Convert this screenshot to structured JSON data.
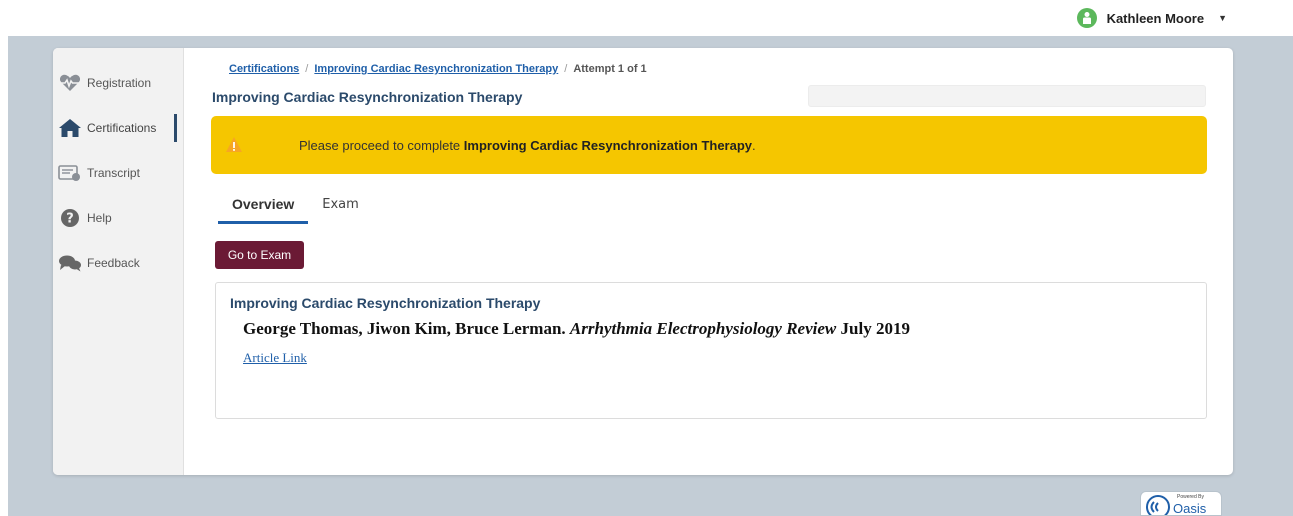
{
  "header": {
    "user_name": "Kathleen Moore"
  },
  "sidebar": {
    "items": [
      {
        "label": "Registration",
        "icon": "heartbeat-icon"
      },
      {
        "label": "Certifications",
        "icon": "home-icon",
        "active": true
      },
      {
        "label": "Transcript",
        "icon": "transcript-icon"
      },
      {
        "label": "Help",
        "icon": "help-icon"
      },
      {
        "label": "Feedback",
        "icon": "feedback-icon"
      }
    ]
  },
  "breadcrumb": {
    "items": [
      "Certifications",
      "Improving Cardiac Resynchronization Therapy"
    ],
    "current": "Attempt 1 of 1"
  },
  "page": {
    "title": "Improving Cardiac Resynchronization Therapy"
  },
  "alert": {
    "prefix": "Please proceed to complete ",
    "bold": "Improving Cardiac Resynchronization Therapy",
    "suffix": "."
  },
  "tabs": [
    {
      "label": "Overview",
      "active": true
    },
    {
      "label": "Exam",
      "active": false
    }
  ],
  "exam_button": {
    "label": "Go to Exam"
  },
  "content": {
    "title": "Improving Cardiac Resynchronization Therapy",
    "authors": "George Thomas, Jiwon Kim, Bruce Lerman. ",
    "journal": "Arrhythmia Electrophysiology Review",
    "date": " July 2019",
    "link_label": "Article Link"
  },
  "footer": {
    "powered_by": "Powered By",
    "brand": "Oasis"
  },
  "colors": {
    "accent": "#2b4a6b",
    "link": "#1f5fa9",
    "alert_bg": "#f5c600",
    "button_bg": "#6b1a35",
    "page_bg": "#c3cdd6",
    "avatar": "#5cb85c"
  }
}
